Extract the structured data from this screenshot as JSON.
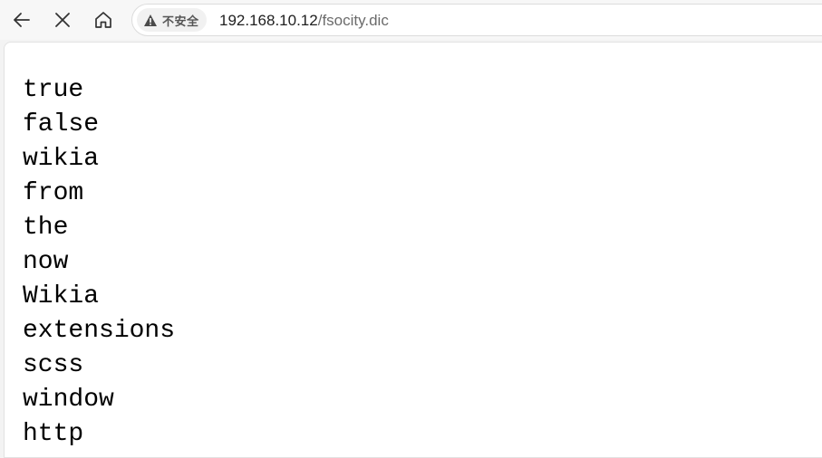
{
  "toolbar": {
    "back_icon": "arrow-left-icon",
    "stop_icon": "close-icon",
    "home_icon": "home-icon"
  },
  "address_bar": {
    "security_icon": "warning-triangle-icon",
    "security_label": "不安全",
    "url_host": "192.168.10.12",
    "url_path": "/fsocity.dic"
  },
  "document": {
    "lines": [
      "true",
      "false",
      "wikia",
      "from",
      "the",
      "now",
      "Wikia",
      "extensions",
      "scss",
      "window",
      "http"
    ]
  }
}
